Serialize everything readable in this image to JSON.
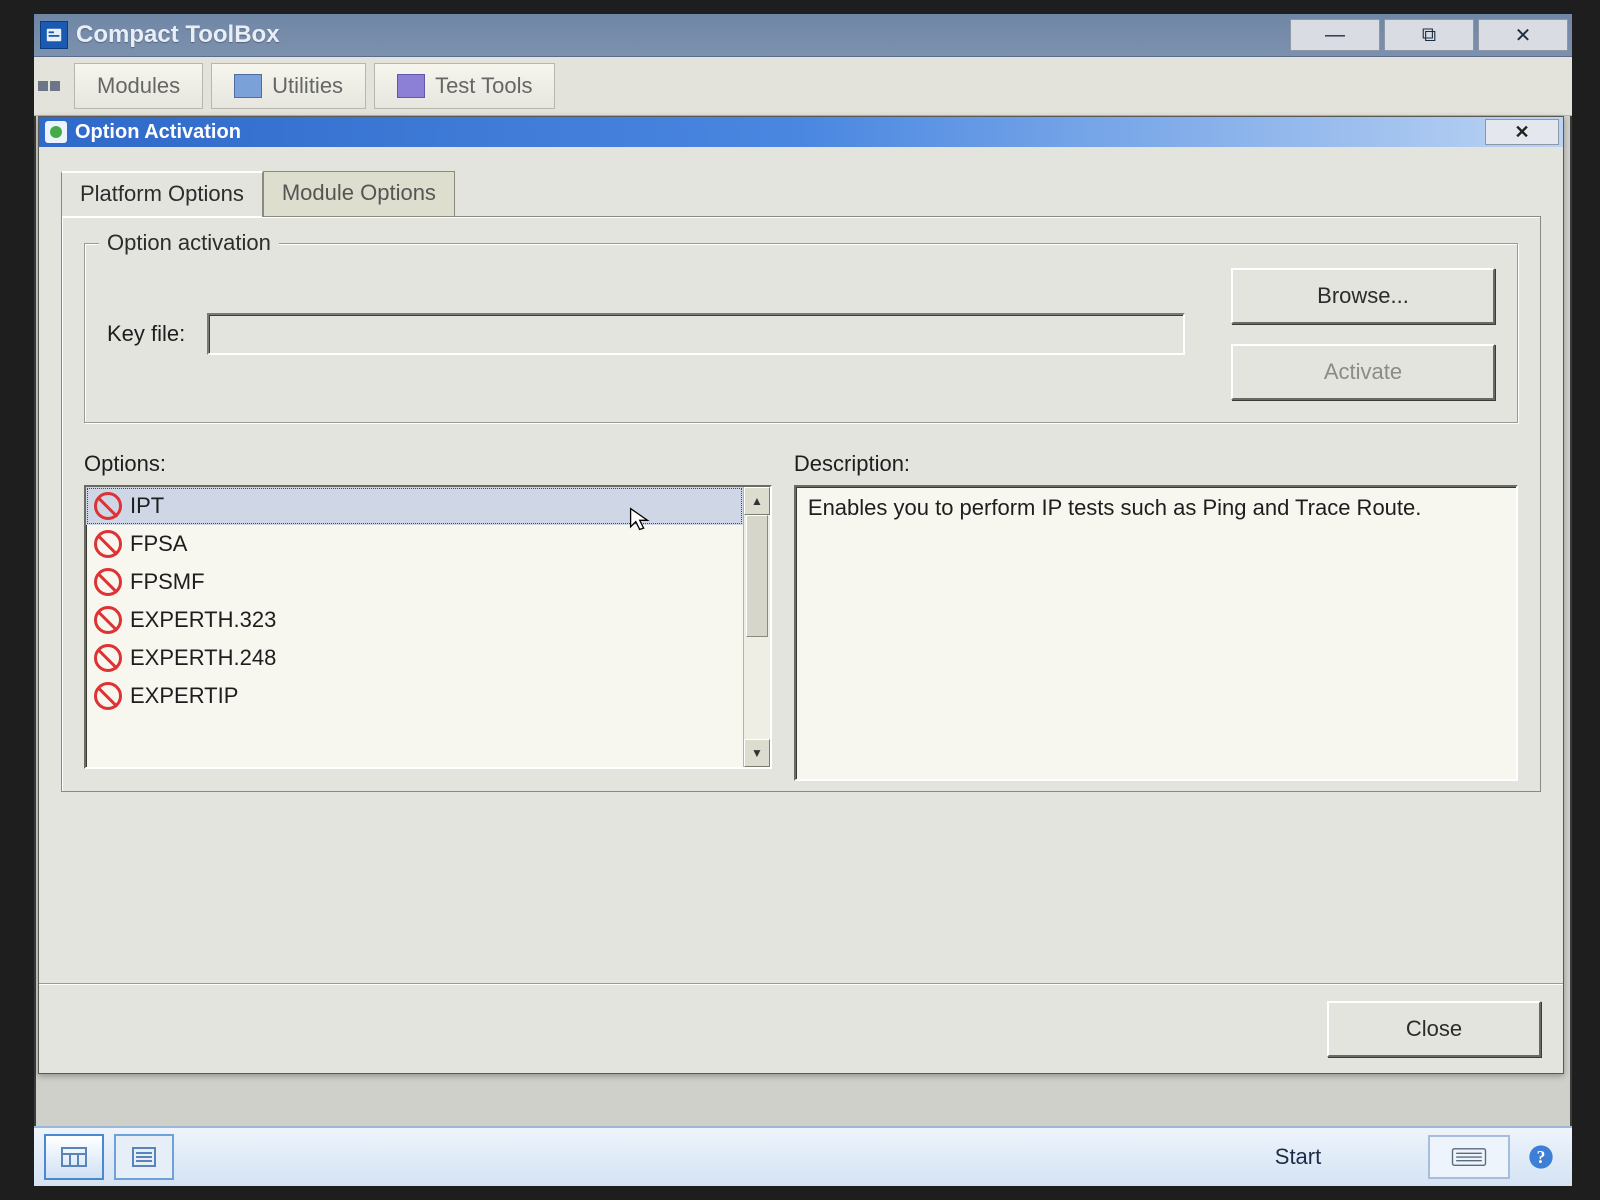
{
  "app": {
    "title": "Compact ToolBox",
    "toolbar": {
      "modules": "Modules",
      "utilities": "Utilities",
      "test_tools": "Test Tools"
    },
    "window_controls": {
      "minimize": "—",
      "restore": "⧉",
      "close": "✕"
    }
  },
  "dialog": {
    "title": "Option Activation",
    "close_x": "✕",
    "tabs": {
      "platform": "Platform Options",
      "module": "Module Options"
    },
    "group": {
      "legend": "Option activation",
      "key_file_label": "Key file:",
      "key_file_value": "",
      "browse": "Browse...",
      "activate": "Activate"
    },
    "options_label": "Options:",
    "description_label": "Description:",
    "options": [
      "IPT",
      "FPSA",
      "FPSMF",
      "EXPERTH.323",
      "EXPERTH.248",
      "EXPERTIP"
    ],
    "selected_index": 0,
    "description": "Enables you to perform IP tests such as Ping and Trace Route.",
    "close_btn": "Close",
    "scroll": {
      "up": "▲",
      "down": "▼"
    }
  },
  "taskbar": {
    "start": "Start",
    "help_glyph": "?"
  }
}
